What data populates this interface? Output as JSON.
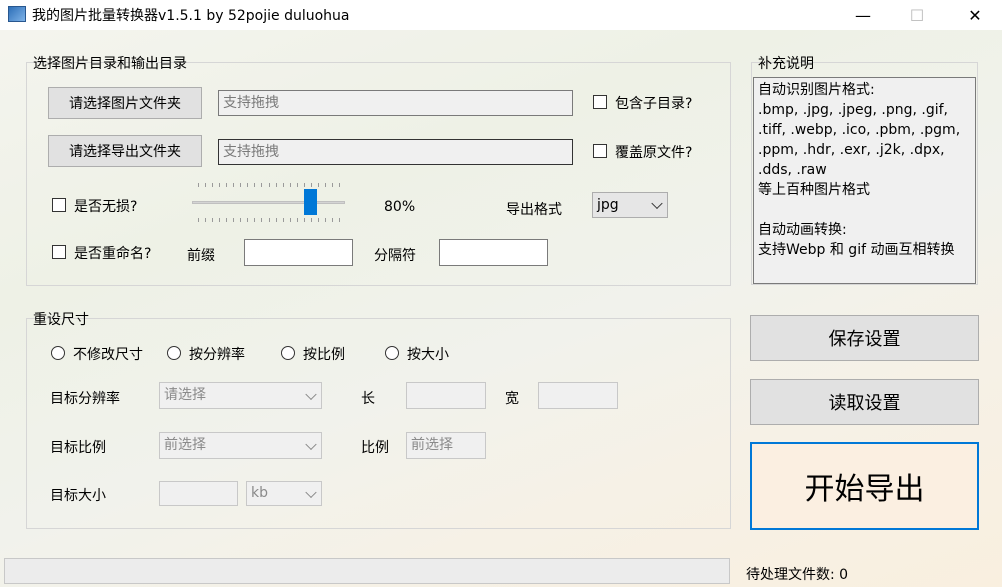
{
  "window": {
    "title": "我的图片批量转换器v1.5.1 by 52pojie duluohua",
    "minimize_glyph": "—",
    "maximize_glyph": "☐",
    "close_glyph": "✕"
  },
  "select_group": {
    "title": "选择图片目录和输出目录",
    "select_image_folder_button": "请选择图片文件夹",
    "image_folder_placeholder": "支持拖拽",
    "include_subdirs_label": "包含子目录?",
    "select_output_folder_button": "请选择导出文件夹",
    "output_folder_placeholder": "支持拖拽",
    "overwrite_label": "覆盖原文件?",
    "lossless_label": "是否无损?",
    "quality_percent": 80,
    "quality_label": "80%",
    "export_format_label": "导出格式",
    "export_format_value": "jpg",
    "rename_label": "是否重命名?",
    "prefix_label": "前缀",
    "separator_label": "分隔符"
  },
  "notes": {
    "title": "补充说明",
    "text": "自动识别图片格式:\n.bmp, .jpg, .jpeg, .png, .gif,\n.tiff, .webp, .ico, .pbm, .pgm,\n.ppm, .hdr, .exr, .j2k, .dpx,\n.dds, .raw\n等上百种图片格式\n\n自动动画转换:\n支持Webp 和 gif 动画互相转换"
  },
  "resize_group": {
    "title": "重设尺寸",
    "options": [
      "不修改尺寸",
      "按分辨率",
      "按比例",
      "按大小"
    ],
    "target_resolution_label": "目标分辨率",
    "resolution_placeholder": "请选择",
    "length_label": "长",
    "width_label": "宽",
    "target_ratio_label": "目标比例",
    "ratio_combo_placeholder": "前选择",
    "ratio_label": "比例",
    "ratio_field_placeholder": "前选择",
    "target_size_label": "目标大小",
    "size_unit": "kb"
  },
  "actions": {
    "save_settings": "保存设置",
    "load_settings": "读取设置",
    "start_export": "开始导出"
  },
  "status": {
    "pending_files": "待处理文件数: 0"
  }
}
